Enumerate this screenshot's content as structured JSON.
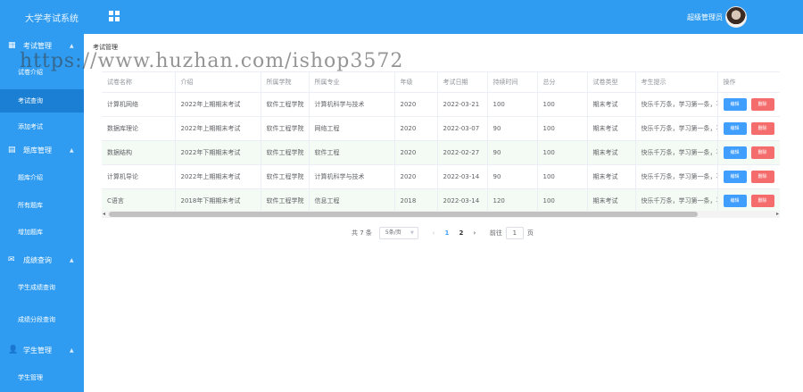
{
  "header": {
    "app_title": "大学考试系统",
    "admin_name": "超级管理员"
  },
  "watermark": "https://www.huzhan.com/ishop3572",
  "sidebar": {
    "groups": [
      {
        "label": "考试管理",
        "icon": "grid-icon",
        "items": [
          "试卷介绍",
          "考试查询",
          "添加考试"
        ]
      },
      {
        "label": "题库管理",
        "icon": "document-icon",
        "items": [
          "题库介绍",
          "所有题库",
          "增加题库"
        ]
      },
      {
        "label": "成绩查询",
        "icon": "message-icon",
        "items": [
          "学生成绩查询",
          "成绩分段查询"
        ]
      },
      {
        "label": "学生管理",
        "icon": "user-icon",
        "items": [
          "学生管理"
        ]
      }
    ],
    "active_item": "考试查询"
  },
  "breadcrumb": "考试管理",
  "table": {
    "columns": [
      "试卷名称",
      "介绍",
      "所属学院",
      "所属专业",
      "年级",
      "考试日期",
      "持续时间",
      "总分",
      "试卷类型",
      "考生提示",
      "操作"
    ],
    "rows": [
      [
        "计算机网络",
        "2022年上期期末考试",
        "软件工程学院",
        "计算机科学与技术",
        "2020",
        "2022-03-21",
        "100",
        "100",
        "期末考试",
        "快乐千万条，学习第一条，平"
      ],
      [
        "数据库理论",
        "2022年上期期末考试",
        "软件工程学院",
        "网络工程",
        "2020",
        "2022-03-07",
        "90",
        "100",
        "期末考试",
        "快乐千万条，学习第一条，平"
      ],
      [
        "数据结构",
        "2022年下期期末考试",
        "软件工程学院",
        "软件工程",
        "2020",
        "2022-02-27",
        "90",
        "100",
        "期末考试",
        "快乐千万条，学习第一条，平"
      ],
      [
        "计算机导论",
        "2022年上期期末考试",
        "软件工程学院",
        "计算机科学与技术",
        "2020",
        "2022-03-14",
        "90",
        "100",
        "期末考试",
        "快乐千万条，学习第一条，平"
      ],
      [
        "C语言",
        "2018年下期期末考试",
        "软件工程学院",
        "信息工程",
        "2018",
        "2022-03-14",
        "120",
        "100",
        "期末考试",
        "快乐千万条，学习第一条，平"
      ]
    ],
    "edit_label": "编辑",
    "delete_label": "删除"
  },
  "pagination": {
    "total_text": "共 7 条",
    "page_size": "5条/页",
    "pages": [
      "1",
      "2"
    ],
    "current_page": "2",
    "goto_prefix": "前往",
    "goto_value": "1",
    "goto_suffix": "页"
  },
  "colors": {
    "header_bg": "#2f9cf1",
    "sidebar_bg": "#2f9cf1",
    "active_item_bg": "#1b7fd3",
    "edit_button": "#409eff",
    "delete_button": "#f56c6c"
  }
}
